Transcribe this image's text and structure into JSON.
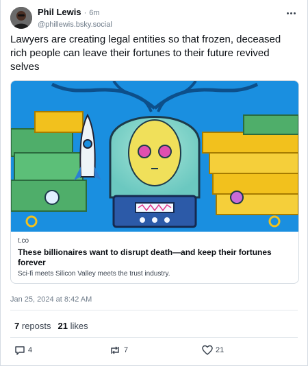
{
  "author": {
    "display_name": "Phil Lewis",
    "time_separator": "·",
    "time": "6m",
    "handle": "@phillewis.bsky.social"
  },
  "post": {
    "text": "Lawyers are creating legal entities so that frozen, deceased rich people can leave their fortunes to their future revived selves"
  },
  "link_card": {
    "domain": "t.co",
    "title": "These billionaires want to disrupt death—and keep their fortunes forever",
    "description": "Sci-fi meets Silicon Valley meets the trust industry.",
    "image_alt": "illustration"
  },
  "timestamp": "Jan 25, 2024 at 8:42 AM",
  "stats": {
    "reposts_count": "7",
    "reposts_label": "reposts",
    "likes_count": "21",
    "likes_label": "likes"
  },
  "actions": {
    "reply_count": "4",
    "repost_count": "7",
    "like_count": "21"
  },
  "colors": {
    "accent_blue": "#1a8fe0",
    "text_primary": "#0b0f14",
    "text_secondary": "#6f7c8a",
    "border": "#d4dbe2",
    "gold": "#f2c11d",
    "money_green": "#4fae6a"
  }
}
